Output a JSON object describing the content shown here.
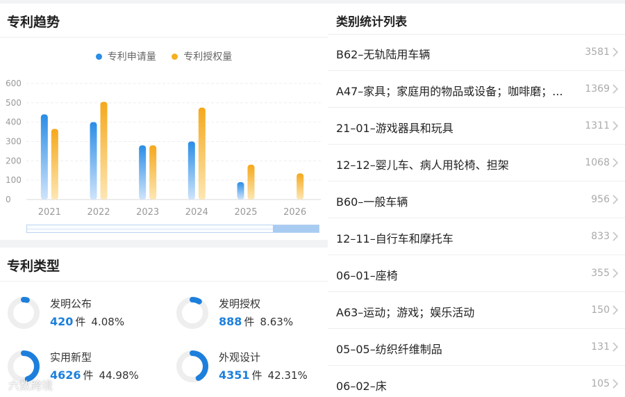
{
  "trend": {
    "title": "专利趋势",
    "legend": [
      {
        "label": "专利申请量",
        "color": "#2a8de6"
      },
      {
        "label": "专利授权量",
        "color": "#f5b021"
      }
    ]
  },
  "chart_data": {
    "type": "bar",
    "categories": [
      "2021",
      "2022",
      "2023",
      "2024",
      "2025",
      "2026"
    ],
    "series": [
      {
        "name": "专利申请量",
        "values": [
          440,
          400,
          280,
          300,
          90,
          0
        ]
      },
      {
        "name": "专利授权量",
        "values": [
          365,
          505,
          280,
          475,
          180,
          135
        ]
      }
    ],
    "ylim": [
      0,
      600
    ],
    "yticks": [
      0,
      100,
      200,
      300,
      400,
      500,
      600
    ],
    "grid": true,
    "legend_position": "top-center"
  },
  "types": {
    "title": "专利类型",
    "items": [
      {
        "name": "发明公布",
        "count": "420",
        "unit": "件",
        "percent": "4.08%",
        "fraction": 0.0408
      },
      {
        "name": "发明授权",
        "count": "888",
        "unit": "件",
        "percent": "8.63%",
        "fraction": 0.0863
      },
      {
        "name": "实用新型",
        "count": "4626",
        "unit": "件",
        "percent": "44.98%",
        "fraction": 0.4498
      },
      {
        "name": "外观设计",
        "count": "4351",
        "unit": "件",
        "percent": "42.31%",
        "fraction": 0.4231
      }
    ]
  },
  "categories_list": {
    "title": "类别统计列表",
    "rows": [
      {
        "label": "B62–无轨陆用车辆",
        "count": "3581"
      },
      {
        "label": "A47–家具；家庭用的物品或设备；咖啡磨；...",
        "count": "1369"
      },
      {
        "label": "21–01–游戏器具和玩具",
        "count": "1311"
      },
      {
        "label": "12–12–婴儿车、病人用轮椅、担架",
        "count": "1068"
      },
      {
        "label": "B60–一般车辆",
        "count": "956"
      },
      {
        "label": "12–11–自行车和摩托车",
        "count": "833"
      },
      {
        "label": "06–01–座椅",
        "count": "355"
      },
      {
        "label": "A63–运动；游戏；娱乐活动",
        "count": "150"
      },
      {
        "label": "05–05–纺织纤维制品",
        "count": "131"
      },
      {
        "label": "06–02–床",
        "count": "105"
      }
    ]
  },
  "watermark": "六数跨境"
}
